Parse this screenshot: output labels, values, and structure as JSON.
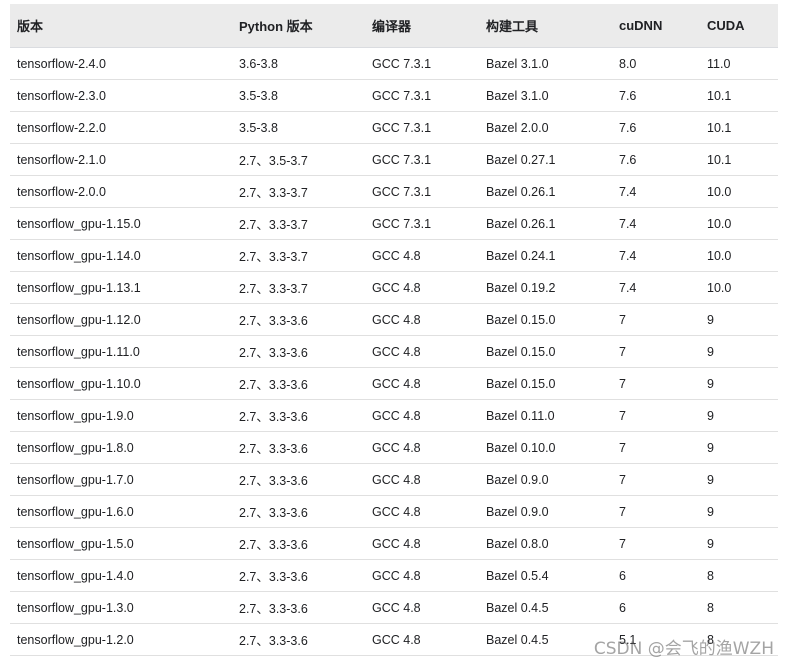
{
  "table": {
    "headers": [
      "版本",
      "Python 版本",
      "编译器",
      "构建工具",
      "cuDNN",
      "CUDA"
    ],
    "rows": [
      [
        "tensorflow-2.4.0",
        "3.6-3.8",
        "GCC 7.3.1",
        "Bazel 3.1.0",
        "8.0",
        "11.0"
      ],
      [
        "tensorflow-2.3.0",
        "3.5-3.8",
        "GCC 7.3.1",
        "Bazel 3.1.0",
        "7.6",
        "10.1"
      ],
      [
        "tensorflow-2.2.0",
        "3.5-3.8",
        "GCC 7.3.1",
        "Bazel 2.0.0",
        "7.6",
        "10.1"
      ],
      [
        "tensorflow-2.1.0",
        "2.7、3.5-3.7",
        "GCC 7.3.1",
        "Bazel 0.27.1",
        "7.6",
        "10.1"
      ],
      [
        "tensorflow-2.0.0",
        "2.7、3.3-3.7",
        "GCC 7.3.1",
        "Bazel 0.26.1",
        "7.4",
        "10.0"
      ],
      [
        "tensorflow_gpu-1.15.0",
        "2.7、3.3-3.7",
        "GCC 7.3.1",
        "Bazel 0.26.1",
        "7.4",
        "10.0"
      ],
      [
        "tensorflow_gpu-1.14.0",
        "2.7、3.3-3.7",
        "GCC 4.8",
        "Bazel 0.24.1",
        "7.4",
        "10.0"
      ],
      [
        "tensorflow_gpu-1.13.1",
        "2.7、3.3-3.7",
        "GCC 4.8",
        "Bazel 0.19.2",
        "7.4",
        "10.0"
      ],
      [
        "tensorflow_gpu-1.12.0",
        "2.7、3.3-3.6",
        "GCC 4.8",
        "Bazel 0.15.0",
        "7",
        "9"
      ],
      [
        "tensorflow_gpu-1.11.0",
        "2.7、3.3-3.6",
        "GCC 4.8",
        "Bazel 0.15.0",
        "7",
        "9"
      ],
      [
        "tensorflow_gpu-1.10.0",
        "2.7、3.3-3.6",
        "GCC 4.8",
        "Bazel 0.15.0",
        "7",
        "9"
      ],
      [
        "tensorflow_gpu-1.9.0",
        "2.7、3.3-3.6",
        "GCC 4.8",
        "Bazel 0.11.0",
        "7",
        "9"
      ],
      [
        "tensorflow_gpu-1.8.0",
        "2.7、3.3-3.6",
        "GCC 4.8",
        "Bazel 0.10.0",
        "7",
        "9"
      ],
      [
        "tensorflow_gpu-1.7.0",
        "2.7、3.3-3.6",
        "GCC 4.8",
        "Bazel 0.9.0",
        "7",
        "9"
      ],
      [
        "tensorflow_gpu-1.6.0",
        "2.7、3.3-3.6",
        "GCC 4.8",
        "Bazel 0.9.0",
        "7",
        "9"
      ],
      [
        "tensorflow_gpu-1.5.0",
        "2.7、3.3-3.6",
        "GCC 4.8",
        "Bazel 0.8.0",
        "7",
        "9"
      ],
      [
        "tensorflow_gpu-1.4.0",
        "2.7、3.3-3.6",
        "GCC 4.8",
        "Bazel 0.5.4",
        "6",
        "8"
      ],
      [
        "tensorflow_gpu-1.3.0",
        "2.7、3.3-3.6",
        "GCC 4.8",
        "Bazel 0.4.5",
        "6",
        "8"
      ],
      [
        "tensorflow_gpu-1.2.0",
        "2.7、3.3-3.6",
        "GCC 4.8",
        "Bazel 0.4.5",
        "5.1",
        "8"
      ]
    ]
  },
  "watermark": "CSDN @会飞的渔WZH"
}
